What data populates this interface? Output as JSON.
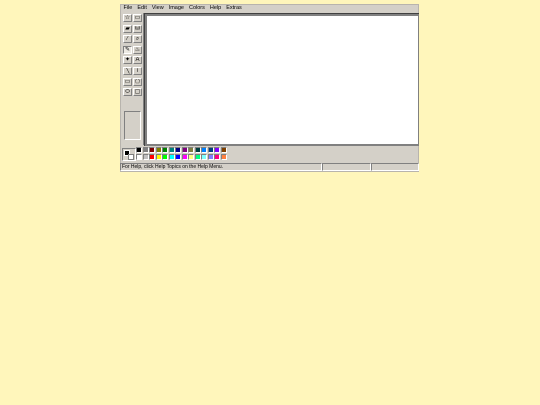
{
  "menubar": {
    "items": [
      {
        "label": "File",
        "name": "menu-file"
      },
      {
        "label": "Edit",
        "name": "menu-edit"
      },
      {
        "label": "View",
        "name": "menu-view"
      },
      {
        "label": "Image",
        "name": "menu-image"
      },
      {
        "label": "Colors",
        "name": "menu-colors"
      },
      {
        "label": "Help",
        "name": "menu-help"
      },
      {
        "label": "Extras",
        "name": "menu-extras"
      }
    ]
  },
  "toolbox": {
    "active_tool": "pencil",
    "tools": [
      {
        "name": "free-form-select-icon",
        "glyph": "☆"
      },
      {
        "name": "rectangle-select-icon",
        "glyph": "▭"
      },
      {
        "name": "eraser-icon",
        "glyph": "▰"
      },
      {
        "name": "fill-icon",
        "glyph": "⛁"
      },
      {
        "name": "pick-color-icon",
        "glyph": "⁄"
      },
      {
        "name": "magnifier-icon",
        "glyph": "⌕"
      },
      {
        "name": "pencil-icon",
        "glyph": "✎"
      },
      {
        "name": "brush-icon",
        "glyph": "♨"
      },
      {
        "name": "airbrush-icon",
        "glyph": "✦"
      },
      {
        "name": "text-icon",
        "glyph": "A"
      },
      {
        "name": "line-icon",
        "glyph": "╲"
      },
      {
        "name": "curve-icon",
        "glyph": "≀"
      },
      {
        "name": "rectangle-icon",
        "glyph": "▭"
      },
      {
        "name": "polygon-icon",
        "glyph": "⬠"
      },
      {
        "name": "ellipse-icon",
        "glyph": "⬭"
      },
      {
        "name": "rounded-rectangle-icon",
        "glyph": "▢"
      }
    ]
  },
  "colors": {
    "foreground": "#000000",
    "background": "#ffffff",
    "palette_top": [
      "#000000",
      "#808080",
      "#800000",
      "#808000",
      "#008000",
      "#008080",
      "#000080",
      "#800080",
      "#808040",
      "#004040",
      "#0080ff",
      "#004080",
      "#8000ff",
      "#804000"
    ],
    "palette_bottom": [
      "#ffffff",
      "#c0c0c0",
      "#ff0000",
      "#ffff00",
      "#00ff00",
      "#00ffff",
      "#0000ff",
      "#ff00ff",
      "#ffff80",
      "#00ff80",
      "#80ffff",
      "#8080ff",
      "#ff0080",
      "#ff8040"
    ]
  },
  "statusbar": {
    "message": "For Help, click Help Topics on the Help Menu.",
    "coordinates": "",
    "size": ""
  }
}
